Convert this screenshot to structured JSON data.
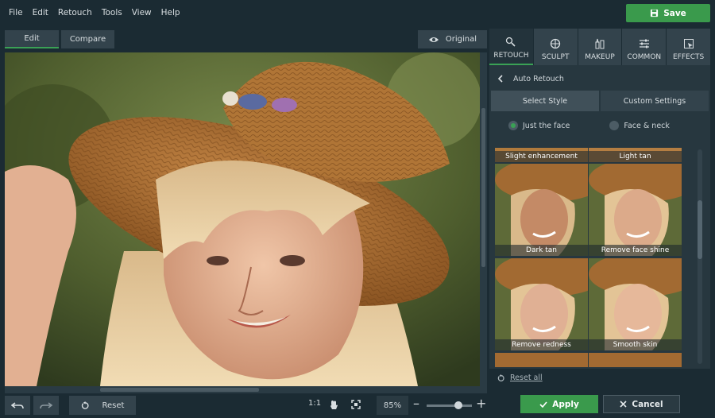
{
  "menu": [
    "File",
    "Edit",
    "Retouch",
    "Tools",
    "View",
    "Help"
  ],
  "save_label": "Save",
  "toolbar": {
    "edit": "Edit",
    "compare": "Compare",
    "original": "Original"
  },
  "bottombar": {
    "reset": "Reset",
    "ratio": "1:1",
    "zoom": "85%",
    "zoom_fraction": 0.7
  },
  "panel": {
    "tabs": [
      {
        "label": "RETOUCH",
        "icon": "retouch-brush-icon"
      },
      {
        "label": "SCULPT",
        "icon": "sculpt-icon"
      },
      {
        "label": "MAKEUP",
        "icon": "makeup-icon"
      },
      {
        "label": "COMMON",
        "icon": "sliders-icon"
      },
      {
        "label": "EFFECTS",
        "icon": "effects-icon"
      }
    ],
    "header": "Auto Retouch",
    "subtabs": [
      "Select Style",
      "Custom Settings"
    ],
    "radios": [
      "Just the face",
      "Face & neck"
    ],
    "styles": [
      "Slight enhancement",
      "Light tan",
      "Dark tan",
      "Remove face shine",
      "Remove redness",
      "Smooth skin"
    ],
    "reset_all": "Reset all"
  },
  "actions": {
    "apply": "Apply",
    "cancel": "Cancel"
  },
  "colors": {
    "accent": "#3a9a4c",
    "bg": "#1b2b33",
    "panel": "#27373f"
  }
}
